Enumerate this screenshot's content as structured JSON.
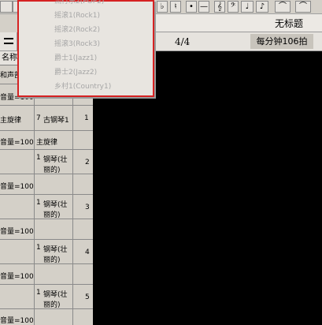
{
  "toolbar": {
    "buttons": [
      "♯",
      "♭",
      "♮",
      "•",
      "—",
      "𝄞",
      "𝄢",
      "♩",
      "♪",
      "⌒",
      "⌒"
    ]
  },
  "document": {
    "title": "无标题",
    "time_signature": "4/4",
    "tempo": "每分钟106拍"
  },
  "track_panel": {
    "header_label": "名称/音量",
    "rows": [
      {
        "left": "和声部",
        "num": "",
        "name": "",
        "idx": ""
      },
      {
        "left": "音量=100",
        "num": "",
        "name": "",
        "idx": ""
      },
      {
        "left": "主旋律",
        "num": "7",
        "name": "古钢琴1",
        "idx": "1"
      },
      {
        "left": "音量=100",
        "num": "",
        "name": "主旋律",
        "idx": ""
      },
      {
        "left": "",
        "num": "1",
        "name": "钢琴(壮丽的)",
        "idx": "2"
      },
      {
        "left": "音量=100",
        "num": "",
        "name": "",
        "idx": ""
      },
      {
        "left": "",
        "num": "1",
        "name": "钢琴(壮丽的)",
        "idx": "3"
      },
      {
        "left": "音量=100",
        "num": "",
        "name": "",
        "idx": ""
      },
      {
        "left": "",
        "num": "1",
        "name": "钢琴(壮丽的)",
        "idx": "4"
      },
      {
        "left": "音量=100",
        "num": "",
        "name": "",
        "idx": ""
      },
      {
        "left": "",
        "num": "1",
        "name": "钢琴(壮丽的)",
        "idx": "5"
      },
      {
        "left": "音量=100",
        "num": "",
        "name": "",
        "idx": ""
      }
    ]
  },
  "style_menu": {
    "items": [
      "流行乐2(POP2)",
      "摇滚1(Rock1)",
      "摇滚2(Rock2)",
      "摇滚3(Rock3)",
      "爵士1(Jazz1)",
      "爵士2(Jazz2)",
      "乡村1(Country1)"
    ]
  }
}
